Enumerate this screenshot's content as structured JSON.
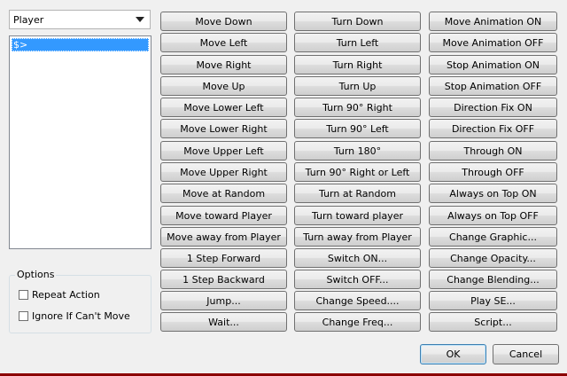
{
  "target": {
    "selected": "Player"
  },
  "route_list": {
    "items": [
      "$>"
    ]
  },
  "options": {
    "legend": "Options",
    "repeat_action": {
      "label": "Repeat Action",
      "checked": false
    },
    "ignore_if_cant_move": {
      "label": "Ignore If Can't Move",
      "checked": false
    }
  },
  "commands": {
    "column1": [
      "Move Down",
      "Move Left",
      "Move Right",
      "Move Up",
      "Move Lower Left",
      "Move Lower Right",
      "Move Upper Left",
      "Move Upper Right",
      "Move at Random",
      "Move toward Player",
      "Move away from Player",
      "1 Step Forward",
      "1 Step Backward",
      "Jump...",
      "Wait..."
    ],
    "column2": [
      "Turn Down",
      "Turn Left",
      "Turn Right",
      "Turn Up",
      "Turn 90° Right",
      "Turn 90° Left",
      "Turn 180°",
      "Turn 90° Right or Left",
      "Turn at Random",
      "Turn toward player",
      "Turn away from Player",
      "Switch ON...",
      "Switch OFF...",
      "Change Speed....",
      "Change Freq..."
    ],
    "column3": [
      "Move Animation ON",
      "Move Animation OFF",
      "Stop Animation ON",
      "Stop Animation OFF",
      "Direction Fix ON",
      "Direction Fix OFF",
      "Through ON",
      "Through OFF",
      "Always on Top ON",
      "Always on Top OFF",
      "Change Graphic...",
      "Change Opacity...",
      "Change Blending...",
      "Play SE...",
      "Script..."
    ]
  },
  "dialog": {
    "ok_label": "OK",
    "cancel_label": "Cancel"
  }
}
